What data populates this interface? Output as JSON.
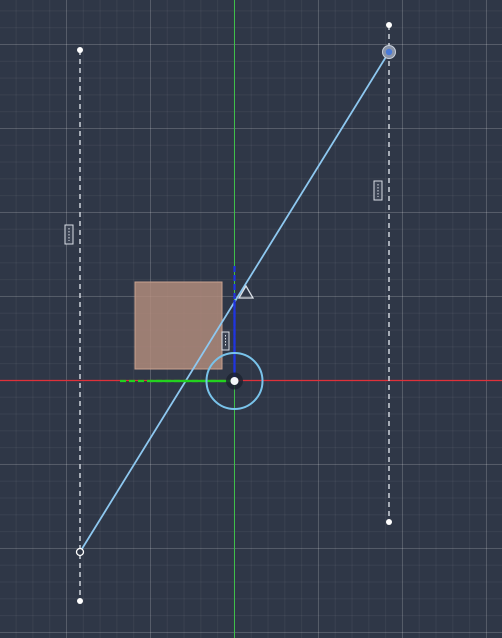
{
  "viewport": {
    "background_color": "#2f3747",
    "grid_color": "#aab4c4",
    "x_axis_color": "#e0313a",
    "y_axis_color": "#3fbf4a"
  },
  "sketch": {
    "guide_line_color": "#d9dee6",
    "selected_line_color": "#8ec8f0",
    "gizmo_ring_color": "#79c3ea",
    "gizmo_x_handle_color": "#23d11f",
    "gizmo_y_handle_color": "#1f35e0",
    "rectangle_fill_color": "#b58e7c",
    "dimension_icon": "dimension-marker-icon",
    "vertex_icon": "vertex-handle-icon",
    "triangle_icon": "triangle-marker-icon",
    "pivot_icon": "pivot-gizmo-icon"
  }
}
